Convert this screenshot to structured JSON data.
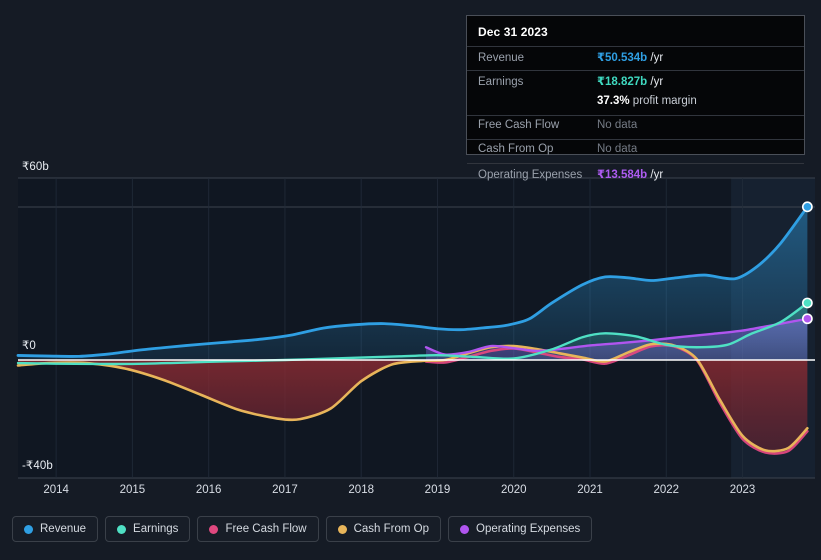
{
  "background_color": "#151b25",
  "tooltip": {
    "date": "Dec 31 2023",
    "rows": [
      {
        "label": "Revenue",
        "value": "₹50.534b",
        "unit": "/yr",
        "color": "#2f9fe3",
        "no_data": false
      },
      {
        "label": "Earnings",
        "value": "₹18.827b",
        "unit": "/yr",
        "color": "#3fd9c0",
        "no_data": false
      },
      {
        "label": "",
        "value": "37.3%",
        "unit": "profit margin",
        "color": "#ffffff",
        "no_data": false
      },
      {
        "label": "Free Cash Flow",
        "value": "No data",
        "unit": "",
        "color": "#767c86",
        "no_data": true
      },
      {
        "label": "Cash From Op",
        "value": "No data",
        "unit": "",
        "color": "#767c86",
        "no_data": true
      },
      {
        "label": "Operating Expenses",
        "value": "₹13.584b",
        "unit": "/yr",
        "color": "#ad5cf0",
        "no_data": false
      }
    ]
  },
  "legend": {
    "items": [
      {
        "label": "Revenue",
        "color": "#2f9fe3"
      },
      {
        "label": "Earnings",
        "color": "#4fe0c4"
      },
      {
        "label": "Free Cash Flow",
        "color": "#e0487f"
      },
      {
        "label": "Cash From Op",
        "color": "#e8b55a"
      },
      {
        "label": "Operating Expenses",
        "color": "#b055ef"
      }
    ]
  },
  "chart_data": {
    "type": "line",
    "title": "",
    "xlabel": "",
    "ylabel": "",
    "grid": true,
    "legend_position": "bottom",
    "currency": "₹",
    "units": "billions",
    "ylim": [
      -40,
      60
    ],
    "y_ticks": [
      60,
      0,
      -40
    ],
    "y_tick_labels": [
      "₹60b",
      "₹0",
      "-₹40b"
    ],
    "x_ticks": [
      2014,
      2015,
      2016,
      2017,
      2018,
      2019,
      2020,
      2021,
      2022,
      2023
    ],
    "x_tick_labels": [
      "2014",
      "2015",
      "2016",
      "2017",
      "2018",
      "2019",
      "2020",
      "2021",
      "2022",
      "2023"
    ],
    "xlim": [
      2013.5,
      2023.95
    ],
    "forecast_start": 2022.85,
    "series": [
      {
        "name": "Revenue",
        "color": "#2f9fe3",
        "x": [
          2013.5,
          2013.9,
          2014.3,
          2014.7,
          2015.1,
          2015.5,
          2015.9,
          2016.3,
          2016.7,
          2017.1,
          2017.5,
          2017.9,
          2018.3,
          2018.7,
          2019.0,
          2019.3,
          2019.6,
          2019.9,
          2020.2,
          2020.5,
          2020.9,
          2021.2,
          2021.5,
          2021.8,
          2022.1,
          2022.5,
          2022.9,
          2023.2,
          2023.5,
          2023.85
        ],
        "values": [
          1.5,
          1.3,
          1.2,
          2.0,
          3.3,
          4.3,
          5.2,
          6.0,
          6.9,
          8.3,
          10.5,
          11.6,
          12.0,
          11.2,
          10.3,
          10.0,
          10.6,
          11.4,
          13.5,
          18.8,
          24.8,
          27.4,
          27.1,
          26.2,
          27.0,
          28.0,
          26.8,
          31.0,
          38.5,
          50.5
        ]
      },
      {
        "name": "Earnings",
        "color": "#4fe0c4",
        "x": [
          2013.5,
          2014.0,
          2014.5,
          2015.0,
          2015.5,
          2016.0,
          2016.5,
          2017.0,
          2017.5,
          2018.0,
          2018.5,
          2019.0,
          2019.5,
          2020.0,
          2020.5,
          2020.9,
          2021.2,
          2021.6,
          2022.0,
          2022.4,
          2022.8,
          2023.1,
          2023.5,
          2023.85
        ],
        "values": [
          -1.0,
          -1.2,
          -1.3,
          -1.3,
          -1.0,
          -0.6,
          -0.3,
          0.0,
          0.4,
          0.8,
          1.2,
          1.6,
          1.0,
          0.5,
          3.5,
          7.5,
          8.8,
          7.8,
          5.0,
          4.2,
          5.0,
          8.5,
          12.5,
          18.8
        ]
      },
      {
        "name": "Free Cash Flow",
        "color": "#e0487f",
        "x": [
          2018.85,
          2019.1,
          2019.4,
          2019.7,
          2020.0,
          2020.3,
          2020.6,
          2020.9,
          2021.2,
          2021.5,
          2021.8,
          2022.1,
          2022.4,
          2022.7,
          2023.0,
          2023.3,
          2023.6,
          2023.85
        ],
        "values": [
          -0.5,
          -0.8,
          1.0,
          3.0,
          3.8,
          2.5,
          1.0,
          0.2,
          -1.2,
          1.5,
          4.5,
          4.5,
          0.0,
          -14.0,
          -26.0,
          -30.5,
          -30.0,
          -23.5
        ]
      },
      {
        "name": "Cash From Op",
        "color": "#e8b55a",
        "x": [
          2013.5,
          2013.9,
          2014.4,
          2014.9,
          2015.4,
          2015.9,
          2016.4,
          2016.9,
          2017.2,
          2017.6,
          2018.0,
          2018.4,
          2018.8,
          2019.1,
          2019.4,
          2019.7,
          2020.0,
          2020.3,
          2020.6,
          2020.9,
          2021.2,
          2021.5,
          2021.8,
          2022.1,
          2022.4,
          2022.7,
          2023.0,
          2023.3,
          2023.6,
          2023.85
        ],
        "values": [
          -1.8,
          -1.0,
          -1.0,
          -2.8,
          -6.5,
          -11.5,
          -16.5,
          -19.3,
          -19.5,
          -16.0,
          -7.0,
          -1.5,
          -0.3,
          0.0,
          2.2,
          4.2,
          4.6,
          3.6,
          2.2,
          0.8,
          -0.5,
          2.5,
          5.2,
          4.8,
          0.3,
          -13.0,
          -25.0,
          -29.8,
          -29.0,
          -22.5
        ]
      },
      {
        "name": "Operating Expenses",
        "color": "#b055ef",
        "x": [
          2018.85,
          2019.1,
          2019.4,
          2019.7,
          2020.0,
          2020.3,
          2020.6,
          2021.0,
          2021.4,
          2021.8,
          2022.2,
          2022.6,
          2023.0,
          2023.4,
          2023.85
        ],
        "values": [
          4.2,
          1.8,
          2.6,
          4.6,
          3.9,
          3.0,
          3.6,
          4.8,
          5.6,
          6.5,
          7.6,
          8.6,
          9.7,
          11.5,
          13.6
        ]
      }
    ]
  }
}
